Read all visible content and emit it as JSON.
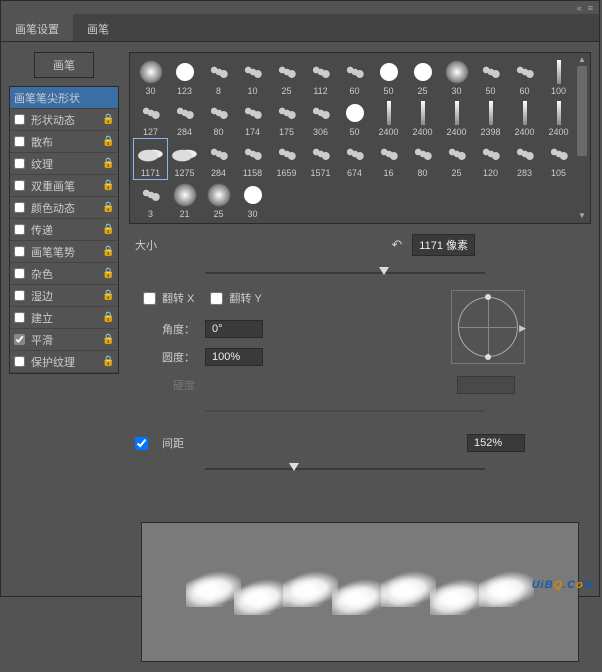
{
  "titlebar": {
    "collapse": "«",
    "menu": "≡"
  },
  "tabs": {
    "settings": "画笔设置",
    "brushes": "画笔"
  },
  "left": {
    "brush_btn": "画笔",
    "tip_shape": "画笔笔尖形状",
    "options": [
      {
        "label": "形状动态",
        "checked": false
      },
      {
        "label": "散布",
        "checked": false
      },
      {
        "label": "纹理",
        "checked": false
      },
      {
        "label": "双重画笔",
        "checked": false
      },
      {
        "label": "颜色动态",
        "checked": false
      },
      {
        "label": "传递",
        "checked": false
      },
      {
        "label": "画笔笔势",
        "checked": false
      },
      {
        "label": "杂色",
        "checked": false
      },
      {
        "label": "湿边",
        "checked": false
      },
      {
        "label": "建立",
        "checked": false
      },
      {
        "label": "平滑",
        "checked": true
      },
      {
        "label": "保护纹理",
        "checked": false
      }
    ]
  },
  "swatches": [
    {
      "s": "30",
      "t": "soft"
    },
    {
      "s": "123",
      "t": "dot"
    },
    {
      "s": "8",
      "t": "splat"
    },
    {
      "s": "10",
      "t": "splat"
    },
    {
      "s": "25",
      "t": "splat"
    },
    {
      "s": "112",
      "t": "splat"
    },
    {
      "s": "60",
      "t": "splat"
    },
    {
      "s": "50",
      "t": "dot"
    },
    {
      "s": "25",
      "t": "dot"
    },
    {
      "s": "30",
      "t": "soft"
    },
    {
      "s": "50",
      "t": "splat"
    },
    {
      "s": "60",
      "t": "splat"
    },
    {
      "s": "100",
      "t": "bar"
    },
    {
      "s": "127",
      "t": "splat"
    },
    {
      "s": "284",
      "t": "splat"
    },
    {
      "s": "80",
      "t": "splat"
    },
    {
      "s": "174",
      "t": "splat"
    },
    {
      "s": "175",
      "t": "splat"
    },
    {
      "s": "306",
      "t": "splat"
    },
    {
      "s": "50",
      "t": "dot"
    },
    {
      "s": "2400",
      "t": "bar"
    },
    {
      "s": "2400",
      "t": "bar"
    },
    {
      "s": "2400",
      "t": "bar"
    },
    {
      "s": "2398",
      "t": "bar"
    },
    {
      "s": "2400",
      "t": "bar"
    },
    {
      "s": "2400",
      "t": "bar"
    },
    {
      "s": "1171",
      "t": "cloud",
      "sel": true
    },
    {
      "s": "1275",
      "t": "cloud"
    },
    {
      "s": "284",
      "t": "splat"
    },
    {
      "s": "1158",
      "t": "splat"
    },
    {
      "s": "1659",
      "t": "splat"
    },
    {
      "s": "1571",
      "t": "splat"
    },
    {
      "s": "674",
      "t": "splat"
    },
    {
      "s": "16",
      "t": "splat"
    },
    {
      "s": "80",
      "t": "splat"
    },
    {
      "s": "25",
      "t": "splat"
    },
    {
      "s": "120",
      "t": "splat"
    },
    {
      "s": "283",
      "t": "splat"
    },
    {
      "s": "105",
      "t": "splat"
    },
    {
      "s": "3",
      "t": "splat"
    },
    {
      "s": "21",
      "t": "soft"
    },
    {
      "s": "25",
      "t": "soft"
    },
    {
      "s": "30",
      "t": "dot"
    }
  ],
  "ctrls": {
    "size_label": "大小",
    "reset_icon": "↶",
    "size_value": "1171 像素",
    "flipx": "翻转 X",
    "flipy": "翻转 Y",
    "angle_label": "角度：",
    "angle_value": "0°",
    "round_label": "圆度：",
    "round_value": "100%",
    "hard_label": "硬度",
    "spacing_label": "间距",
    "spacing_value": "152%"
  },
  "watermark": {
    "t1": "UiB",
    "t2": "Q",
    "t3": ".C",
    "t4": "o",
    "t5": "M"
  }
}
